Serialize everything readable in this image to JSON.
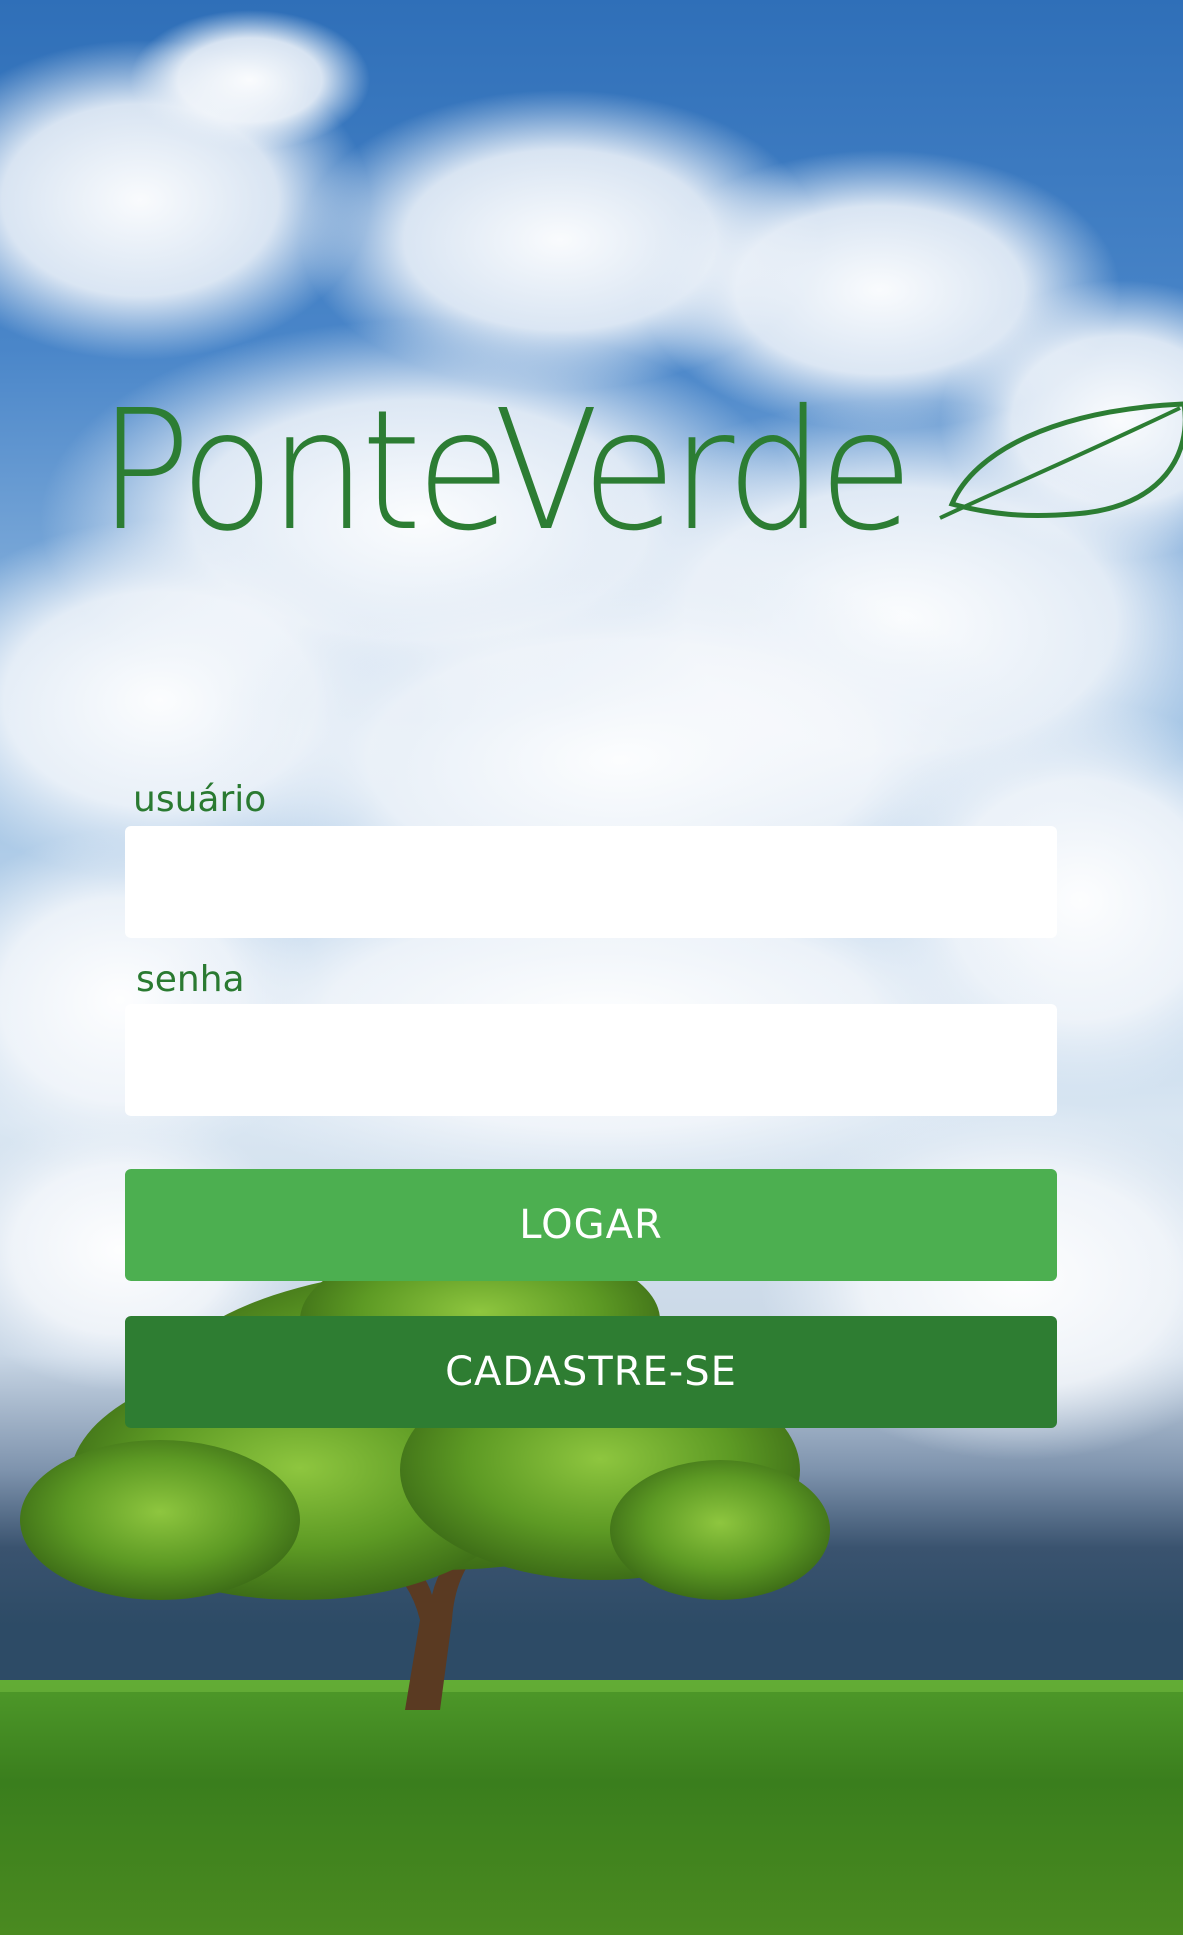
{
  "app": {
    "logo_text": "PonteVerde",
    "logo_icon": "leaf-icon"
  },
  "login_form": {
    "username_label": "usuário",
    "username_value": "",
    "password_label": "senha",
    "password_value": "",
    "login_button": "LOGAR",
    "signup_button": "CADASTRE-SE"
  },
  "colors": {
    "brand_green": "#2c7d33",
    "login_button": "#4caf50",
    "signup_button": "#2e7d32",
    "input_background": "#ffffff"
  }
}
